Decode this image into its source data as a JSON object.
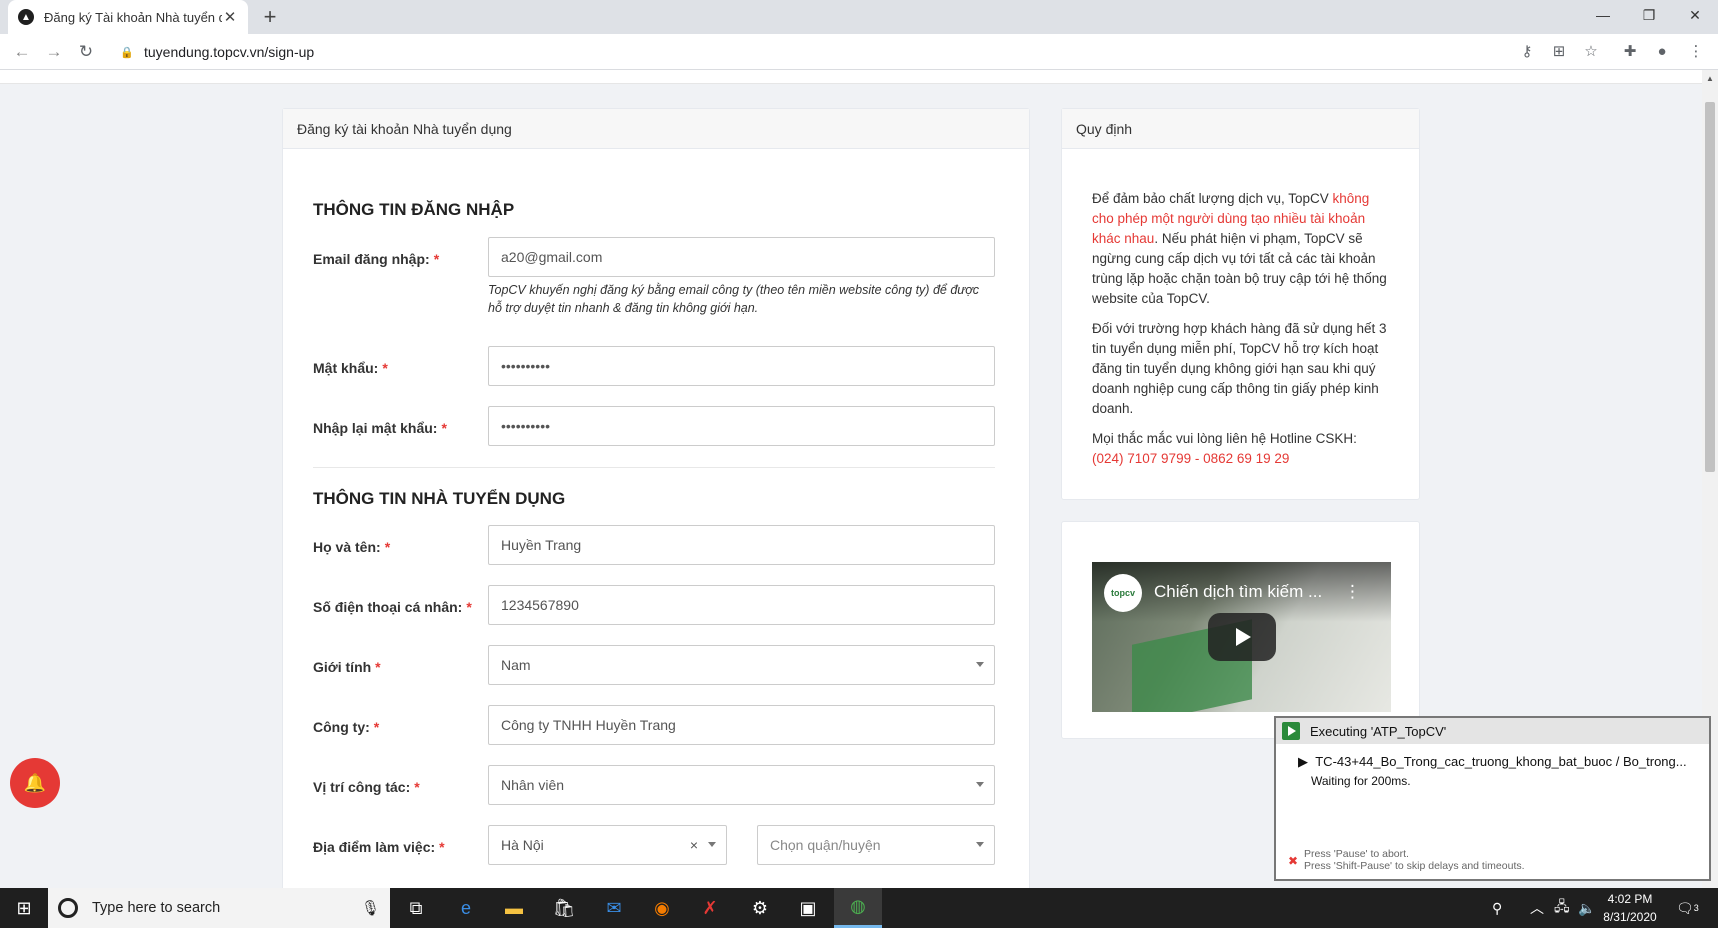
{
  "browser": {
    "tab_title": "Đăng ký Tài khoản Nhà tuyển dụ",
    "url": "tuyendung.topcv.vn/sign-up"
  },
  "signup_card": {
    "header": "Đăng ký tài khoản Nhà tuyển dụng",
    "login_section_title": "THÔNG TIN ĐĂNG NHẬP",
    "email_label": "Email đăng nhập:",
    "email_value": "a20@gmail.com",
    "email_hint": "TopCV khuyến nghị đăng ký bằng email công ty (theo tên miền website công ty) để được hỗ trợ duyệt tin nhanh & đăng tin không giới hạn.",
    "password_label": "Mật khẩu:",
    "password_value": "••••••••••",
    "confirm_password_label": "Nhập lại mật khẩu:",
    "confirm_password_value": "••••••••••",
    "employer_section_title": "THÔNG TIN NHÀ TUYỂN DỤNG",
    "fullname_label": "Họ và tên:",
    "fullname_value": "Huyền Trang",
    "phone_label": "Số điện thoại cá nhân:",
    "phone_value": "1234567890",
    "gender_label": "Giới tính",
    "gender_value": "Nam",
    "company_label": "Công ty:",
    "company_value": "Công ty TNHH Huyền Trang",
    "position_label": "Vị trí công tác:",
    "position_value": "Nhân viên",
    "location_label": "Địa điểm làm việc:",
    "location_value": "Hà Nội",
    "district_placeholder": "Chọn quận/huyện",
    "required_mark": "*"
  },
  "rules_card": {
    "header": "Quy định",
    "p1_a": "Để đảm bảo chất lượng dịch vụ, TopCV ",
    "p1_red": "không cho phép một người dùng tạo nhiều tài khoản khác nhau",
    "p1_b": ". Nếu phát hiện vi phạm, TopCV sẽ ngừng cung cấp dịch vụ tới tất cả các tài khoản trùng lặp hoặc chặn toàn bộ truy cập tới hệ thống website của TopCV.",
    "p2": "Đối với trường hợp khách hàng đã sử dụng hết 3 tin tuyển dụng miễn phí, TopCV hỗ trợ kích hoạt đăng tin tuyển dụng không giới hạn sau khi quý doanh nghiệp cung cấp thông tin giấy phép kinh doanh.",
    "p3": "Mọi thắc mắc vui lòng liên hệ Hotline CSKH:",
    "hotline": "(024) 7107 9799 - 0862 69 19 29"
  },
  "video": {
    "channel": "topcv",
    "title": "Chiến dịch tìm kiếm ..."
  },
  "executing_popup": {
    "title": "Executing 'ATP_TopCV'",
    "test_case": "TC-43+44_Bo_Trong_cac_truong_khong_bat_buoc  / Bo_trong...",
    "status": "Waiting for 200ms.",
    "footer_line1": "Press 'Pause' to abort.",
    "footer_line2": "Press 'Shift-Pause' to skip delays and timeouts."
  },
  "taskbar": {
    "search_placeholder": "Type here to search",
    "time": "4:02 PM",
    "date": "8/31/2020",
    "notification_count": "3"
  },
  "colors": {
    "accent_red": "#e53935",
    "page_bg": "#f0f2f5"
  }
}
